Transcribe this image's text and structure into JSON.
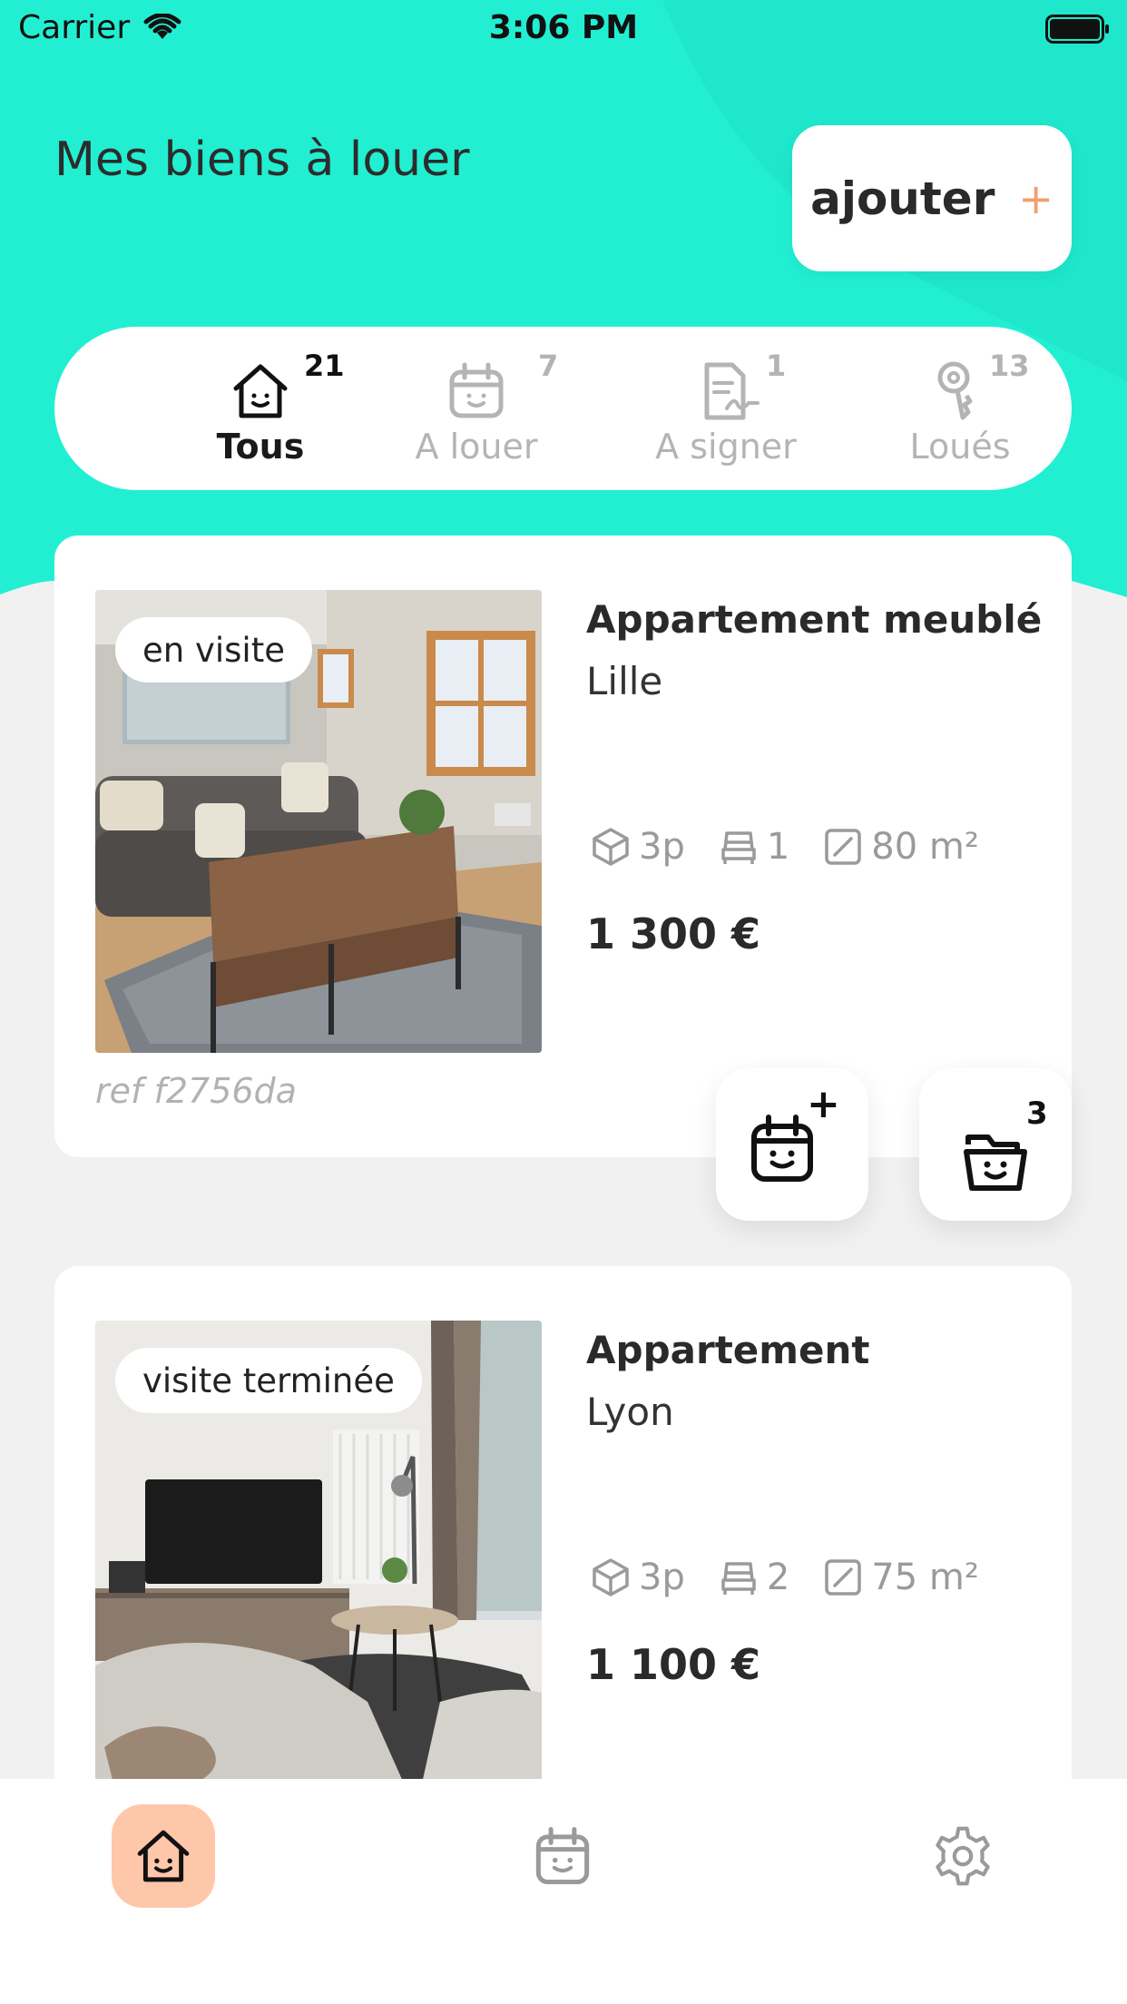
{
  "status_bar": {
    "carrier": "Carrier",
    "time": "3:06 PM"
  },
  "header": {
    "title": "Mes biens à louer",
    "add_label": "ajouter",
    "add_plus": "+",
    "colors": {
      "accent": "#22efd2",
      "accent_dark": "#0fd9bc",
      "add_plus": "#f0a070"
    }
  },
  "tabs": [
    {
      "label": "Tous",
      "count": "21",
      "icon": "house-smile-icon",
      "active": true
    },
    {
      "label": "A louer",
      "count": "7",
      "icon": "calendar-smile-icon",
      "active": false
    },
    {
      "label": "A signer",
      "count": "1",
      "icon": "contract-sign-icon",
      "active": false
    },
    {
      "label": "Loués",
      "count": "13",
      "icon": "key-icon",
      "active": false
    }
  ],
  "properties": [
    {
      "status": "en visite",
      "title": "Appartement meublé",
      "city": "Lille",
      "rooms": "3p",
      "beds": "1",
      "area": "80 m²",
      "price": "1 300 €",
      "ref": "ref f2756da",
      "actions": {
        "add_visit_badge": "+",
        "folder_badge": "3"
      }
    },
    {
      "status": "visite terminée",
      "title": "Appartement",
      "city": "Lyon",
      "rooms": "3p",
      "beds": "2",
      "area": "75 m²",
      "price": "1 100 €"
    }
  ],
  "bottom_nav": [
    {
      "icon": "house-smile-icon",
      "active": true,
      "active_color": "#ffc7a9"
    },
    {
      "icon": "calendar-smile-icon",
      "active": false
    },
    {
      "icon": "gear-icon",
      "active": false
    }
  ]
}
